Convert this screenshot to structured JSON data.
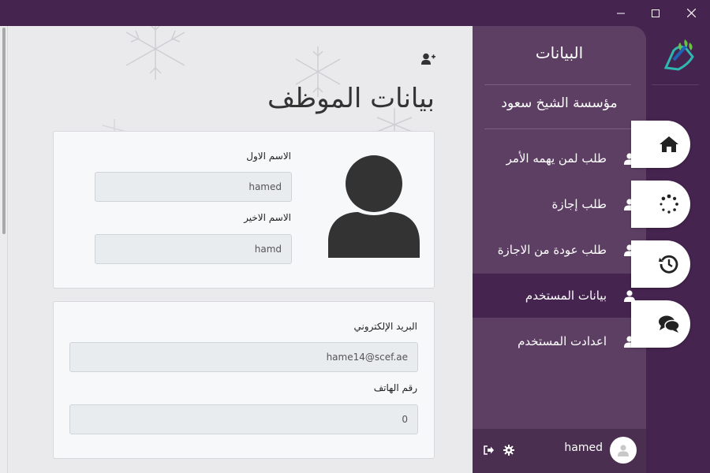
{
  "window": {
    "minimize": "—",
    "maximize": "☐",
    "close": "✕"
  },
  "page": {
    "title": "بيانات الموظف"
  },
  "form": {
    "first_name_label": "الاسم الاول",
    "first_name_value": "hamed",
    "last_name_label": "الاسم الاخير",
    "last_name_value": "hamd",
    "email_label": "البريد الإلكتروني",
    "email_value": "hame14@scef.ae",
    "phone_label": "رقم الهاتف",
    "phone_value": "0"
  },
  "nav": {
    "title": "البيانات",
    "org": "مؤسسة الشيخ سعود",
    "items": [
      {
        "label": "طلب لمن يهمه الأمر"
      },
      {
        "label": "طلب إجازة"
      },
      {
        "label": "طلب عودة من الاجازة"
      },
      {
        "label": "بيانات المستخدم",
        "active": true
      },
      {
        "label": "اعدادت المستخدم"
      }
    ],
    "footer": {
      "user_name": "hamed"
    }
  },
  "side_buttons": [
    "home-icon",
    "spinner-icon",
    "history-icon",
    "chat-icon"
  ],
  "colors": {
    "primary": "#45244f",
    "nav": "#5d3f63",
    "content_bg": "#eaeaec"
  }
}
